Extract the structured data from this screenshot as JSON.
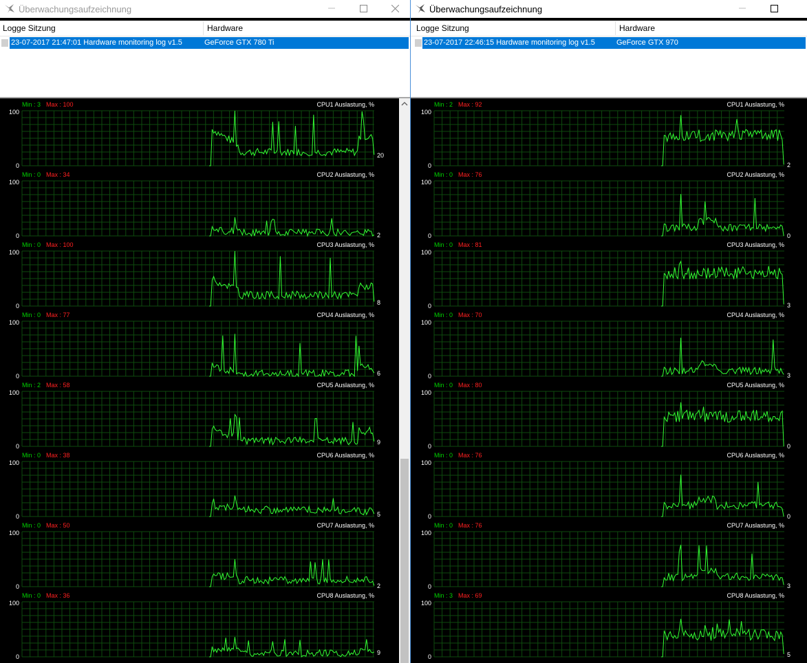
{
  "colors": {
    "selection": "#0078d7",
    "trace": "#33ff33",
    "grid": "#0e4a0e",
    "min": "#00d000",
    "max": "#ff2020"
  },
  "windows": [
    {
      "title": "Überwachungsaufzeichnung",
      "active": false,
      "controls": [
        "minimize-icon",
        "maximize-icon",
        "close-icon"
      ],
      "columns": [
        "Logge Sitzung",
        "Hardware"
      ],
      "row": {
        "session": "23-07-2017 21:47:01 Hardware monitoring log v1.5",
        "hardware": "GeForce GTX 780 Ti"
      },
      "graphs": [
        {
          "title": "CPU1 Auslastung, %",
          "min": "Min : 3",
          "max": "Max : 100",
          "axis_max": "100",
          "axis_min": "0",
          "current": "20",
          "shape": "spike",
          "base": 25,
          "peak": 100,
          "tail": 65
        },
        {
          "title": "CPU2 Auslastung, %",
          "min": "Min : 0",
          "max": "Max : 34",
          "axis_max": "100",
          "axis_min": "0",
          "current": "2",
          "shape": "low",
          "base": 6,
          "peak": 34,
          "tail": 8
        },
        {
          "title": "CPU3 Auslastung, %",
          "min": "Min : 0",
          "max": "Max : 100",
          "axis_max": "100",
          "axis_min": "0",
          "current": "8",
          "shape": "spike",
          "base": 20,
          "peak": 100,
          "tail": 45
        },
        {
          "title": "CPU4 Auslastung, %",
          "min": "Min : 0",
          "max": "Max : 77",
          "axis_max": "100",
          "axis_min": "0",
          "current": "6",
          "shape": "low",
          "base": 5,
          "peak": 77,
          "tail": 20
        },
        {
          "title": "CPU5 Auslastung, %",
          "min": "Min : 2",
          "max": "Max : 58",
          "axis_max": "100",
          "axis_min": "0",
          "current": "9",
          "shape": "low",
          "base": 10,
          "peak": 58,
          "tail": 35
        },
        {
          "title": "CPU6 Auslastung, %",
          "min": "Min : 0",
          "max": "Max : 38",
          "axis_max": "100",
          "axis_min": "0",
          "current": "5",
          "shape": "low",
          "base": 12,
          "peak": 38,
          "tail": 12
        },
        {
          "title": "CPU7 Auslastung, %",
          "min": "Min : 0",
          "max": "Max : 50",
          "axis_max": "100",
          "axis_min": "0",
          "current": "2",
          "shape": "low",
          "base": 12,
          "peak": 50,
          "tail": 15
        },
        {
          "title": "CPU8 Auslastung, %",
          "min": "Min : 0",
          "max": "Max : 36",
          "axis_max": "100",
          "axis_min": "0",
          "current": "9",
          "shape": "low",
          "base": 7,
          "peak": 36,
          "tail": 12
        }
      ]
    },
    {
      "title": "Überwachungsaufzeichnung",
      "active": true,
      "controls": [
        "minimize-icon",
        "maximize-icon"
      ],
      "columns": [
        "Logge Sitzung",
        "Hardware"
      ],
      "row": {
        "session": "23-07-2017 22:46:15 Hardware monitoring log v1.5",
        "hardware": "GeForce GTX 970"
      },
      "graphs": [
        {
          "title": "CPU1 Auslastung, %",
          "min": "Min : 2",
          "max": "Max : 92",
          "axis_max": "100",
          "axis_min": "0",
          "current": "2",
          "shape": "high",
          "base": 55,
          "peak": 92,
          "tail": 50
        },
        {
          "title": "CPU2 Auslastung, %",
          "min": "Min : 0",
          "max": "Max : 76",
          "axis_max": "100",
          "axis_min": "0",
          "current": "0",
          "shape": "mid",
          "base": 15,
          "peak": 76,
          "tail": 15
        },
        {
          "title": "CPU3 Auslastung, %",
          "min": "Min : 0",
          "max": "Max : 81",
          "axis_max": "100",
          "axis_min": "0",
          "current": "3",
          "shape": "high",
          "base": 60,
          "peak": 81,
          "tail": 60
        },
        {
          "title": "CPU4 Auslastung, %",
          "min": "Min : 0",
          "max": "Max : 70",
          "axis_max": "100",
          "axis_min": "0",
          "current": "3",
          "shape": "mid",
          "base": 10,
          "peak": 70,
          "tail": 10
        },
        {
          "title": "CPU5 Auslastung, %",
          "min": "Min : 0",
          "max": "Max : 80",
          "axis_max": "100",
          "axis_min": "0",
          "current": "0",
          "shape": "high",
          "base": 55,
          "peak": 80,
          "tail": 55
        },
        {
          "title": "CPU6 Auslastung, %",
          "min": "Min : 0",
          "max": "Max : 76",
          "axis_max": "100",
          "axis_min": "0",
          "current": "0",
          "shape": "mid",
          "base": 20,
          "peak": 76,
          "tail": 20
        },
        {
          "title": "CPU7 Auslastung, %",
          "min": "Min : 0",
          "max": "Max : 76",
          "axis_max": "100",
          "axis_min": "0",
          "current": "3",
          "shape": "mid",
          "base": 18,
          "peak": 76,
          "tail": 18
        },
        {
          "title": "CPU8 Auslastung, %",
          "min": "Min : 3",
          "max": "Max : 69",
          "axis_max": "100",
          "axis_min": "0",
          "current": "5",
          "shape": "high",
          "base": 40,
          "peak": 69,
          "tail": 35
        }
      ]
    }
  ]
}
